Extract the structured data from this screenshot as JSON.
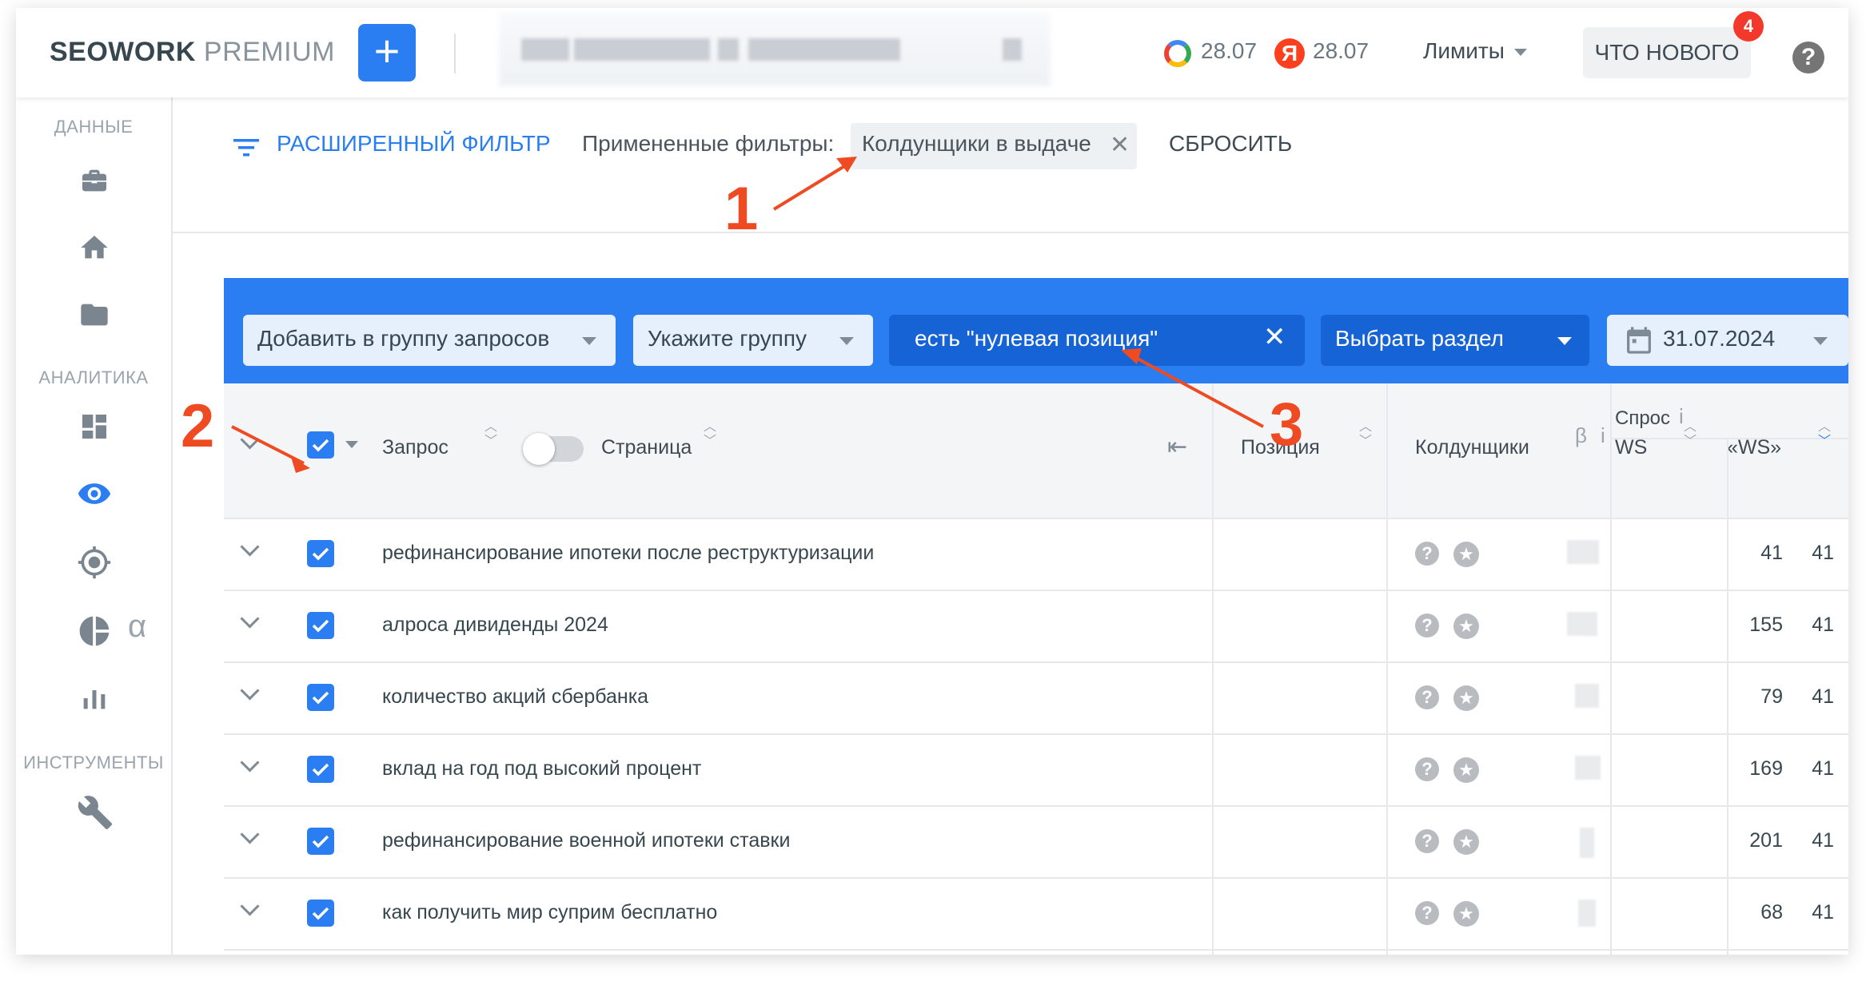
{
  "header": {
    "logo_bold": "SEOWORK",
    "logo_rest": " PREMIUM",
    "add_symbol": "+",
    "google_date": "28.07",
    "yandex_letter": "Я",
    "yandex_date": "28.07",
    "limits_label": "Лимиты",
    "whats_new_label": "ЧТО НОВОГО",
    "whats_new_count": "4",
    "help_symbol": "?"
  },
  "sidebar": {
    "sections": [
      {
        "label": "ДАННЫЕ",
        "icons": [
          "briefcase-icon",
          "home-icon",
          "folder-icon"
        ]
      },
      {
        "label": "АНАЛИТИКА",
        "icons": [
          "dashboard-icon",
          "eye-icon",
          "target-icon",
          "pie-chart-icon",
          "bar-chart-icon"
        ]
      },
      {
        "label": "ИНСТРУМЕНТЫ",
        "icons": [
          "wrench-icon"
        ]
      }
    ],
    "alpha_label": "α",
    "active_icon": "eye-icon"
  },
  "filter": {
    "advanced_label": "РАСШИРЕННЫЙ ФИЛЬТР",
    "applied_label": "Примененные фильтры:",
    "chip_label": "Колдунщики в выдаче",
    "reset_label": "СБРОСИТЬ"
  },
  "toolbar": {
    "add_to_group": "Добавить в группу запросов",
    "select_group": "Укажите группу",
    "active_filter": "есть \"нулевая позиция\"",
    "select_section": "Выбрать раздел",
    "date": "31.07.2024"
  },
  "table": {
    "headers": {
      "query": "Запрос",
      "page": "Страница",
      "position": "Позиция",
      "wizards": "Колдунщики",
      "wizards_beta": "β",
      "info": "i",
      "demand": "Спрос",
      "ws": "WS",
      "ws_quoted": "«WS»"
    },
    "rows": [
      {
        "query": "рефинансирование ипотеки после реструктуризации",
        "ws": "41",
        "ws_quoted": "41"
      },
      {
        "query": "алроса дивиденды 2024",
        "ws": "155",
        "ws_quoted": "41"
      },
      {
        "query": "количество акций сбербанка",
        "ws": "79",
        "ws_quoted": "41"
      },
      {
        "query": "вклад на год под высокий процент",
        "ws": "169",
        "ws_quoted": "41"
      },
      {
        "query": "рефинансирование военной ипотеки ставки",
        "ws": "201",
        "ws_quoted": "41"
      },
      {
        "query": "как получить мир суприм бесплатно",
        "ws": "68",
        "ws_quoted": "41"
      }
    ]
  },
  "annotations": [
    "1",
    "2",
    "3"
  ],
  "colors": {
    "accent": "#2a7ef2",
    "annotation": "#ef4b23",
    "badge": "#f3392b"
  }
}
